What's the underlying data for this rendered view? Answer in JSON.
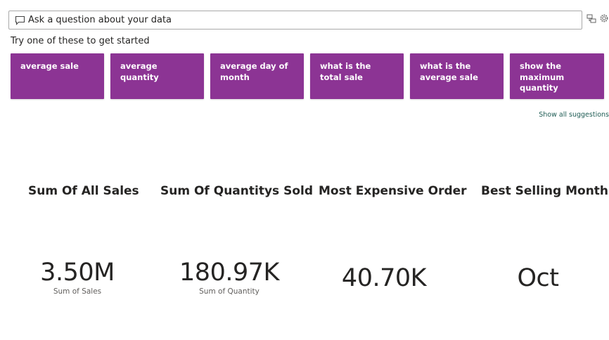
{
  "qa": {
    "placeholder": "Ask a question about your data",
    "hint": "Try one of these to get started",
    "suggestions": [
      "average sale",
      "average quantity",
      "average day of month",
      "what is the total sale",
      "what is the average sale",
      "show the maximum quantity"
    ],
    "show_all": "Show all suggestions"
  },
  "cards": [
    {
      "title": "Sum Of All Sales",
      "value": "3.50M",
      "subtitle": "Sum of Sales"
    },
    {
      "title": "Sum Of Quantitys Sold",
      "value": "180.97K",
      "subtitle": "Sum of Quantity"
    },
    {
      "title": "Most Expensive Order",
      "value": "40.70K",
      "subtitle": ""
    },
    {
      "title": "Best Selling Month",
      "value": "Oct",
      "subtitle": ""
    }
  ],
  "colors": {
    "chip_bg": "#8c3494",
    "link": "#1d5b53"
  },
  "icons": [
    "chat-icon",
    "share-icon",
    "gear-icon"
  ]
}
